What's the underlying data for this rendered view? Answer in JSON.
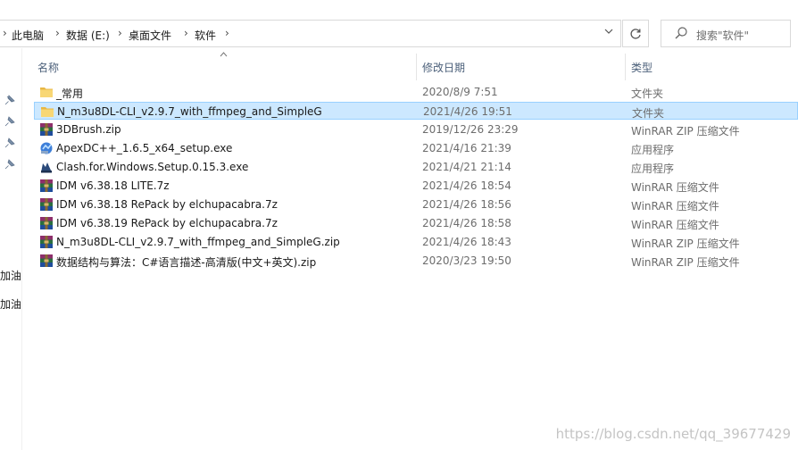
{
  "breadcrumb": {
    "items": [
      "此电脑",
      "数据 (E:)",
      "桌面文件",
      "软件"
    ],
    "separator": "›"
  },
  "search": {
    "placeholder": "搜索\"软件\""
  },
  "nav_pane": {
    "partial_labels": [
      "加油",
      "加油"
    ]
  },
  "columns": {
    "name": "名称",
    "modified": "修改日期",
    "type": "类型"
  },
  "files": [
    {
      "name": "_常用",
      "date": "2020/8/9 7:51",
      "type": "文件夹",
      "icon": "folder-icon",
      "selected": false
    },
    {
      "name": "N_m3u8DL-CLI_v2.9.7_with_ffmpeg_and_SimpleG",
      "date": "2021/4/26 19:51",
      "type": "文件夹",
      "icon": "folder-icon",
      "selected": true
    },
    {
      "name": "3DBrush.zip",
      "date": "2019/12/26 23:29",
      "type": "WinRAR ZIP 压缩文件",
      "icon": "winrar-icon",
      "selected": false
    },
    {
      "name": "ApexDC++_1.6.5_x64_setup.exe",
      "date": "2021/4/16 21:39",
      "type": "应用程序",
      "icon": "installer-icon",
      "selected": false
    },
    {
      "name": "Clash.for.Windows.Setup.0.15.3.exe",
      "date": "2021/4/21 21:14",
      "type": "应用程序",
      "icon": "clash-icon",
      "selected": false
    },
    {
      "name": "IDM v6.38.18 LITE.7z",
      "date": "2021/4/26 18:54",
      "type": "WinRAR 压缩文件",
      "icon": "winrar-icon",
      "selected": false
    },
    {
      "name": "IDM v6.38.18 RePack by elchupacabra.7z",
      "date": "2021/4/26 18:56",
      "type": "WinRAR 压缩文件",
      "icon": "winrar-icon",
      "selected": false
    },
    {
      "name": "IDM v6.38.19 RePack by elchupacabra.7z",
      "date": "2021/4/26 18:58",
      "type": "WinRAR 压缩文件",
      "icon": "winrar-icon",
      "selected": false
    },
    {
      "name": "N_m3u8DL-CLI_v2.9.7_with_ffmpeg_and_SimpleG.zip",
      "date": "2021/4/26 18:43",
      "type": "WinRAR ZIP 压缩文件",
      "icon": "winrar-icon",
      "selected": false
    },
    {
      "name": "数据结构与算法：C#语言描述-高清版(中文+英文).zip",
      "date": "2020/3/23 19:50",
      "type": "WinRAR ZIP 压缩文件",
      "icon": "winrar-icon",
      "selected": false
    }
  ],
  "watermark": "https://blog.csdn.net/qq_39677429",
  "colors": {
    "selection_bg": "#cce8ff",
    "selection_border": "#99d1ff",
    "header_text": "#4c607a",
    "folder_yellow": "#f8d775"
  }
}
